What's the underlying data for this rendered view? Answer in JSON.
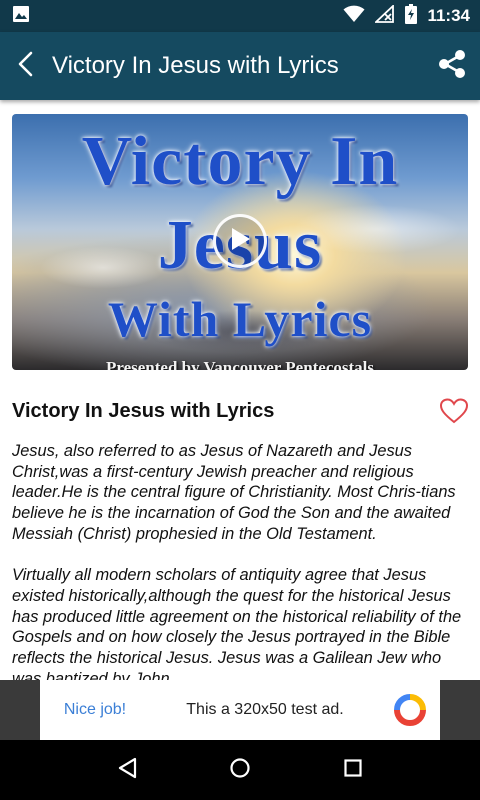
{
  "status_bar": {
    "time": "11:34",
    "icons": [
      "image-notification-icon",
      "wifi-icon",
      "no-signal-icon",
      "battery-charging-icon"
    ]
  },
  "app_bar": {
    "title": "Victory In Jesus with Lyrics",
    "back_icon": "back-arrow-icon",
    "share_icon": "share-icon",
    "background": "#154a60"
  },
  "video": {
    "line1": "Victory In",
    "line2": "Jesus",
    "line3": "With Lyrics",
    "footer": "Presented by Vancouver Pentecostals",
    "play_icon": "play-icon"
  },
  "song": {
    "title": "Victory In Jesus with Lyrics",
    "favorite_icon": "heart-outline-icon",
    "favorite_color": "#e0474c"
  },
  "description": {
    "paragraph1": "Jesus, also referred to as Jesus of Nazareth and Jesus Christ,was a first-century Jewish preacher and religious leader.He is the central figure of Christianity. Most Chris-tians believe he is the incarnation of God the Son and the awaited Messiah (Christ) prophesied in the Old Testament.",
    "paragraph2": "Virtually all modern scholars of antiquity agree that Jesus existed historically,although the quest for the historical Jesus has produced little agreement on the historical reliability of the Gospels and on how closely the Jesus portrayed in the Bible reflects the historical Jesus. Jesus was a Galilean Jew who was baptized by John"
  },
  "ad": {
    "nice_job": "Nice job!",
    "text": "This a 320x50 test ad.",
    "logo_icon": "ad-logo-icon"
  },
  "nav_bar": {
    "back_icon": "nav-back-icon",
    "home_icon": "nav-home-icon",
    "recents_icon": "nav-recents-icon"
  }
}
